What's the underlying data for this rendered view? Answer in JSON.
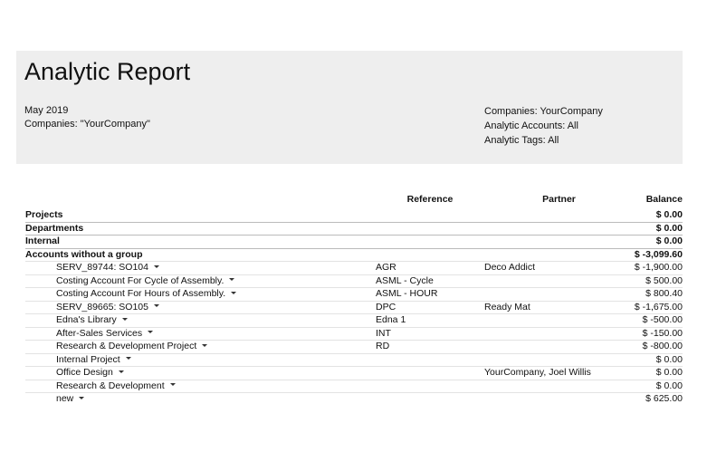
{
  "header": {
    "title": "Analytic Report",
    "left": [
      "May 2019",
      "Companies: \"YourCompany\""
    ],
    "right": [
      "Companies: YourCompany",
      "Analytic Accounts: All",
      "Analytic Tags: All"
    ]
  },
  "table": {
    "columns": {
      "name": "",
      "reference": "Reference",
      "partner": "Partner",
      "balance": "Balance"
    },
    "groups": [
      {
        "name": "Projects",
        "balance": "$ 0.00"
      },
      {
        "name": "Departments",
        "balance": "$ 0.00"
      },
      {
        "name": "Internal",
        "balance": "$ 0.00"
      },
      {
        "name": "Accounts without a group",
        "balance": "$ -3,099.60"
      }
    ],
    "accounts": [
      {
        "name": "SERV_89744: SO104",
        "reference": "AGR",
        "partner": "Deco Addict",
        "balance": "$ -1,900.00"
      },
      {
        "name": "Costing Account For Cycle of Assembly.",
        "reference": "ASML - Cycle",
        "partner": "",
        "balance": "$ 500.00"
      },
      {
        "name": "Costing Account For Hours of Assembly.",
        "reference": "ASML - HOUR",
        "partner": "",
        "balance": "$ 800.40"
      },
      {
        "name": "SERV_89665: SO105",
        "reference": "DPC",
        "partner": "Ready Mat",
        "balance": "$ -1,675.00"
      },
      {
        "name": "Edna's Library",
        "reference": "Edna 1",
        "partner": "",
        "balance": "$ -500.00"
      },
      {
        "name": "After-Sales Services",
        "reference": "INT",
        "partner": "",
        "balance": "$ -150.00"
      },
      {
        "name": "Research & Development Project",
        "reference": "RD",
        "partner": "",
        "balance": "$ -800.00"
      },
      {
        "name": "Internal Project",
        "reference": "",
        "partner": "",
        "balance": "$ 0.00"
      },
      {
        "name": "Office Design",
        "reference": "",
        "partner": "YourCompany, Joel Willis",
        "balance": "$ 0.00"
      },
      {
        "name": "Research & Development",
        "reference": "",
        "partner": "",
        "balance": "$ 0.00"
      },
      {
        "name": "new",
        "reference": "",
        "partner": "",
        "balance": "$ 625.00"
      }
    ]
  }
}
